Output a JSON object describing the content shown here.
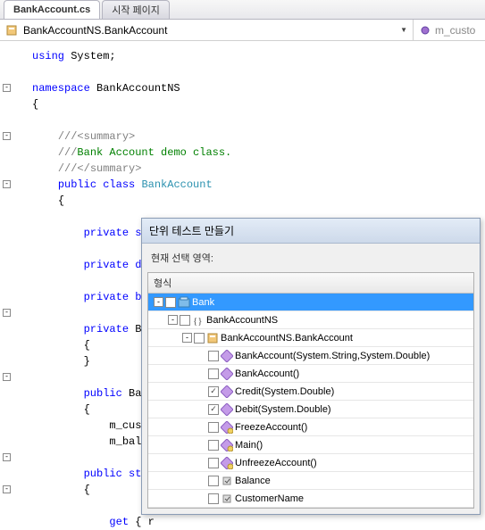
{
  "tabs": [
    {
      "label": "BankAccount.cs",
      "active": true
    },
    {
      "label": "시작 페이지",
      "active": false
    }
  ],
  "class_dropdown": {
    "icon": "class-icon",
    "text": "BankAccountNS.BankAccount"
  },
  "member_dropdown": {
    "icon": "field-icon",
    "text": "m_custo"
  },
  "code": {
    "l1_using": "using",
    "l1_sys": " System;",
    "l3_ns": "namespace",
    "l3_name": " BankAccountNS",
    "l4": "{",
    "l6a": "///",
    "l6b": "<summary>",
    "l7a": "///",
    "l7b": "Bank Account demo class.",
    "l8a": "///",
    "l8b": "</summary>",
    "l9a": "public",
    "l9b": " class",
    "l9c": " BankAccount",
    "l10": "{",
    "l12a": "private",
    "l12b": " str",
    "l14a": "private",
    "l14b": " dou",
    "l16a": "private",
    "l16b": " boo",
    "l18a": "private",
    "l18b": " Ban",
    "l19": "{",
    "l20": "}",
    "l22a": "public",
    "l22b": " Bank",
    "l23": "{",
    "l24": "m_custo",
    "l25": "m_balan",
    "l27a": "public",
    "l27b": " stri",
    "l28": "{",
    "l29a": "get",
    "l29b": " { r"
  },
  "popup": {
    "title": "단위 테스트 만들기",
    "subtitle": "현재 선택 영역:",
    "header": "형식",
    "tree": [
      {
        "depth": 0,
        "exp": "-",
        "chk": "",
        "icon": "assembly-icon",
        "label": "Bank",
        "sel": true
      },
      {
        "depth": 1,
        "exp": "-",
        "chk": "",
        "icon": "namespace-icon",
        "label": "BankAccountNS"
      },
      {
        "depth": 2,
        "exp": "-",
        "chk": "",
        "icon": "class-icon",
        "label": "BankAccountNS.BankAccount"
      },
      {
        "depth": 3,
        "chk": "",
        "icon": "method-icon",
        "label": "BankAccount(System.String,System.Double)"
      },
      {
        "depth": 3,
        "chk": "",
        "icon": "method-icon",
        "label": "BankAccount()"
      },
      {
        "depth": 3,
        "chk": "checked",
        "icon": "method-icon",
        "label": "Credit(System.Double)"
      },
      {
        "depth": 3,
        "chk": "checked",
        "icon": "method-icon",
        "label": "Debit(System.Double)"
      },
      {
        "depth": 3,
        "chk": "",
        "icon": "method-priv-icon",
        "label": "FreezeAccount()"
      },
      {
        "depth": 3,
        "chk": "",
        "icon": "method-priv-icon",
        "label": "Main()"
      },
      {
        "depth": 3,
        "chk": "",
        "icon": "method-priv-icon",
        "label": "UnfreezeAccount()"
      },
      {
        "depth": 3,
        "chk": "",
        "icon": "property-icon",
        "label": "Balance"
      },
      {
        "depth": 3,
        "chk": "",
        "icon": "property-icon",
        "label": "CustomerName"
      }
    ]
  }
}
